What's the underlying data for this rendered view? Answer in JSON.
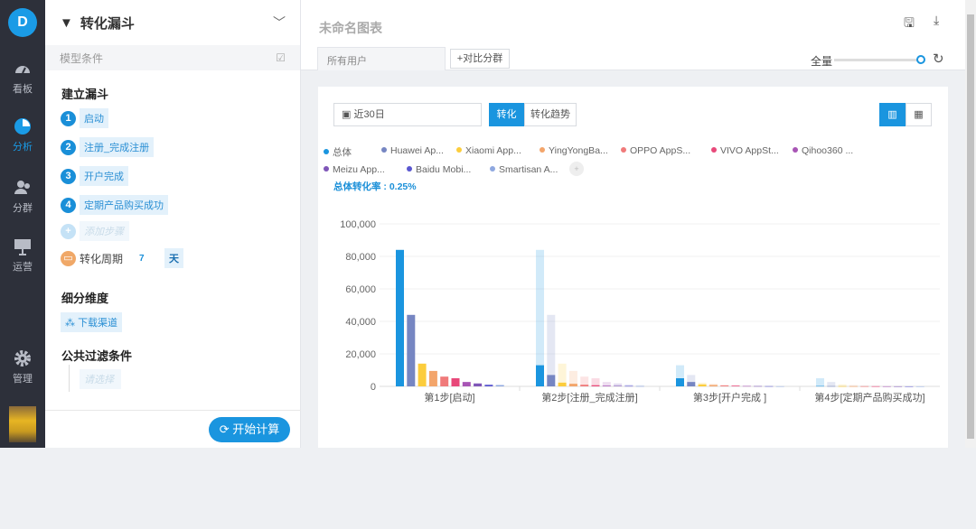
{
  "nav": {
    "avatar": "D",
    "items": [
      {
        "label": "看板",
        "icon": "dashboard-icon"
      },
      {
        "label": "分析",
        "icon": "pie-chart-icon"
      },
      {
        "label": "分群",
        "icon": "users-icon"
      },
      {
        "label": "运营",
        "icon": "presentation-icon"
      },
      {
        "label": "管理",
        "icon": "gear-icon"
      }
    ],
    "active": "分析"
  },
  "panel": {
    "title": "转化漏斗",
    "model_conditions": "模型条件",
    "build_funnel": "建立漏斗",
    "steps": [
      {
        "n": "1",
        "label": "启动"
      },
      {
        "n": "2",
        "label": "注册_完成注册"
      },
      {
        "n": "3",
        "label": "开户完成"
      },
      {
        "n": "4",
        "label": "定期产品购买成功"
      }
    ],
    "add_step": "添加步骤",
    "period_label": "转化周期",
    "period_value": "7",
    "period_unit": "天",
    "breakdown": "细分维度",
    "breakdown_value": "下载渠道",
    "filter": "公共过滤条件",
    "filter_placeholder": "请选择",
    "calc": "开始计算"
  },
  "header": {
    "title": "未命名图表",
    "tab_all": "所有用户",
    "compare": "+对比分群",
    "scope": "全量",
    "scope_value": 1.0
  },
  "toolbar": {
    "date": "近30日",
    "mode_conv": "转化",
    "mode_trend": "转化趋势"
  },
  "overall_rate": "总体转化率 : 0.25%",
  "colors": {
    "accent": "#1a95df"
  },
  "chart_data": {
    "type": "bar",
    "ylim": [
      0,
      100000
    ],
    "yticks": [
      "0",
      "20,000",
      "40,000",
      "60,000",
      "80,000",
      "100,000"
    ],
    "categories": [
      "第1步[启动]",
      "第2步[注册_完成注册]",
      "第3步[开户完成 ]",
      "第4步[定期产品购买成功]"
    ],
    "series": [
      {
        "name": "总体",
        "color": "#1a95df",
        "values": [
          84000,
          13000,
          5000,
          210
        ]
      },
      {
        "name": "Huawei Ap...",
        "color": "#7686c2",
        "values": [
          44000,
          7000,
          2700,
          120
        ]
      },
      {
        "name": "Xiaomi App...",
        "color": "#fccd3c",
        "values": [
          14000,
          2300,
          1200,
          50
        ]
      },
      {
        "name": "YingYongBa...",
        "color": "#f3a56b",
        "values": [
          9500,
          1600,
          800,
          30
        ]
      },
      {
        "name": "OPPO AppS...",
        "color": "#f07a7a",
        "values": [
          6000,
          1000,
          500,
          20
        ]
      },
      {
        "name": "VIVO AppSt...",
        "color": "#e8497a",
        "values": [
          5000,
          700,
          400,
          15
        ]
      },
      {
        "name": "Qihoo360 ...",
        "color": "#a855b5",
        "values": [
          2700,
          400,
          200,
          10
        ]
      },
      {
        "name": "Meizu App...",
        "color": "#7f56b8",
        "values": [
          1800,
          300,
          150,
          8
        ]
      },
      {
        "name": "Baidu Mobi...",
        "color": "#5a57d0",
        "values": [
          1000,
          200,
          100,
          5
        ]
      },
      {
        "name": "Smartisan A...",
        "color": "#8fa8e0",
        "values": [
          800,
          100,
          50,
          3
        ]
      }
    ]
  }
}
